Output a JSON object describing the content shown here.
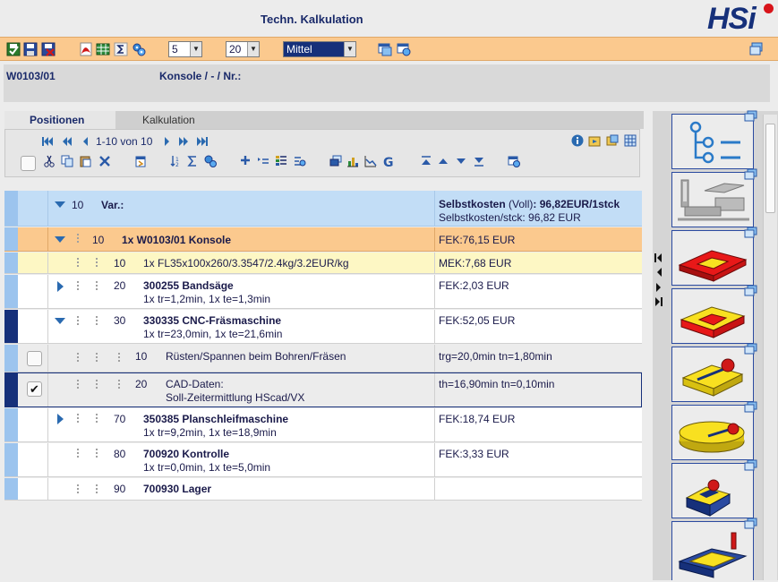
{
  "header": {
    "title": "Techn. Kalkulation",
    "logo_text": "HSi"
  },
  "toolbar": {
    "icons": [
      "check-save-icon",
      "save-icon",
      "delete-save-icon",
      "pdf-icon",
      "export-table-icon",
      "sum-icon",
      "gears-icon",
      "window-icon",
      "window-gears-icon",
      "help-stack-icon"
    ],
    "select_1": "5",
    "select_2": "20",
    "select_mode": "Mittel"
  },
  "info": {
    "left": "W0103/01",
    "middle": "Konsole / - / Nr.:"
  },
  "tabs": [
    {
      "label": "Positionen",
      "active": true
    },
    {
      "label": "Kalkulation",
      "active": false
    }
  ],
  "pager": {
    "text": "1-10 von 10"
  },
  "rows": [
    {
      "pos": "10",
      "title": "Var.:",
      "cost1_bold": "Selbstkosten",
      "cost1_rest": " (Voll)",
      "cost1_value": ": 96,82EUR/1stck",
      "cost2": "Selbstkosten/stck: 96,82 EUR"
    },
    {
      "pos": "10",
      "title": "1x W0103/01 Konsole",
      "cost": "FEK:76,15 EUR"
    },
    {
      "pos": "10",
      "title": "1x FL35x100x260/3.3547/2.4kg/3.2EUR/kg",
      "cost": "MEK:7,68 EUR"
    },
    {
      "pos": "20",
      "title": "300255 Bandsäge",
      "sub": "1x tr=1,2min, 1x te=1,3min",
      "cost": "FEK:2,03 EUR"
    },
    {
      "pos": "30",
      "title": "330335 CNC-Fräsmaschine",
      "sub": "1x tr=23,0min, 1x te=21,6min",
      "cost": "FEK:52,05 EUR"
    },
    {
      "pos": "10",
      "title": "Rüsten/Spannen beim Bohren/Fräsen",
      "cost": "trg=20,0min tn=1,80min"
    },
    {
      "pos": "20",
      "title": "CAD-Daten:",
      "sub": "Soll-Zeitermittlung HScad/VX",
      "cost": "th=16,90min tn=0,10min"
    },
    {
      "pos": "70",
      "title": "350385 Planschleifmaschine",
      "sub": "1x tr=9,2min, 1x te=18,9min",
      "cost": "FEK:18,74 EUR"
    },
    {
      "pos": "80",
      "title": "700920 Kontrolle",
      "sub": "1x tr=0,0min, 1x te=5,0min",
      "cost": "FEK:3,33 EUR"
    },
    {
      "pos": "90",
      "title": "700930 Lager",
      "cost": ""
    }
  ],
  "colors": {
    "accent": "#16307a",
    "toolbar": "#fbc98e",
    "row_var": "#c2ddf6",
    "row_header": "#fbc98e",
    "row_material": "#fdf7c4",
    "stripe": "#9cc4ee"
  }
}
